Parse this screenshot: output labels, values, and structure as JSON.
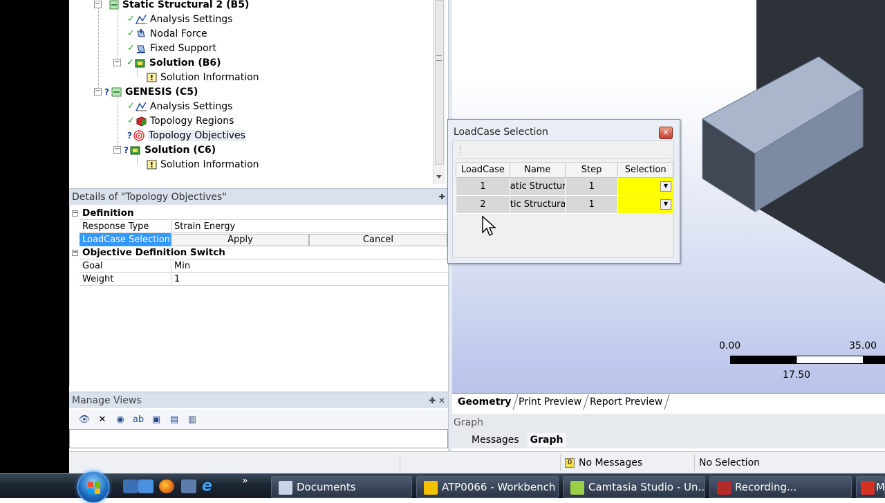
{
  "tree": {
    "items": [
      {
        "label": "Static Structural 2 (B5)",
        "bold": true
      },
      {
        "label": "Analysis Settings",
        "bold": false
      },
      {
        "label": "Nodal Force",
        "bold": false
      },
      {
        "label": "Fixed Support",
        "bold": false
      },
      {
        "label": "Solution (B6)",
        "bold": true
      },
      {
        "label": "Solution Information",
        "bold": false
      },
      {
        "label": "GENESIS (C5)",
        "bold": true
      },
      {
        "label": "Analysis Settings",
        "bold": false
      },
      {
        "label": "Topology Regions",
        "bold": false
      },
      {
        "label": "Topology Objectives",
        "bold": false
      },
      {
        "label": "Solution (C6)",
        "bold": true
      },
      {
        "label": "Solution Information",
        "bold": false
      }
    ]
  },
  "details": {
    "title": "Details of \"Topology Objectives\"",
    "pin_icon": "pin-icon",
    "sections": [
      {
        "name": "Definition",
        "rows": [
          {
            "key": "Response Type",
            "value": "Strain Energy"
          },
          {
            "key": "LoadCase Selection",
            "apply": "Apply",
            "cancel": "Cancel"
          }
        ]
      },
      {
        "name": "Objective Definition Switch",
        "rows": [
          {
            "key": "Goal",
            "value": "Min"
          },
          {
            "key": "Weight",
            "value": "1"
          }
        ]
      }
    ]
  },
  "manage_views": {
    "title": "Manage Views",
    "controls": "⿒ ✕"
  },
  "viewport": {
    "scale": {
      "left": "0.00",
      "right": "35.00",
      "mid": "17.50"
    },
    "tabs": [
      "Geometry",
      "Print Preview",
      "Report Preview"
    ]
  },
  "graph": {
    "title": "Graph",
    "tabs": [
      "Messages",
      "Graph"
    ]
  },
  "status": {
    "messages": "No Messages",
    "selection": "No Selection"
  },
  "dialog": {
    "title": "LoadCase Selection",
    "columns": [
      "LoadCase",
      "Name",
      "Step",
      "Selection"
    ],
    "rows": [
      {
        "loadcase": "1",
        "name": "atic Structur",
        "step": "1",
        "selection": ""
      },
      {
        "loadcase": "2",
        "name": "tic Structura",
        "step": "1",
        "selection": ""
      }
    ]
  },
  "taskbar": {
    "overflow": "»",
    "buttons": [
      {
        "label": "Documents"
      },
      {
        "label": "ATP0066 - Workbench"
      },
      {
        "label": "Camtasia Studio - Un..."
      },
      {
        "label": "Recording..."
      },
      {
        "label": "M"
      }
    ]
  },
  "colors": {
    "selection_blue": "#3399ff",
    "selection_yellow": "#ffff00",
    "taskbar": "#1d2633"
  }
}
